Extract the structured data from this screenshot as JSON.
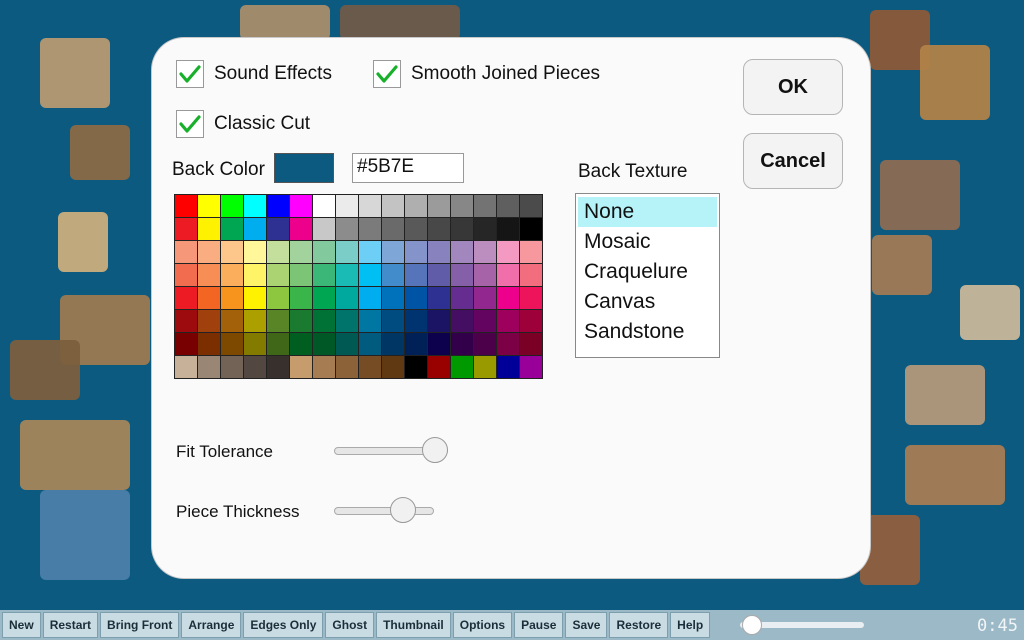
{
  "dialog": {
    "sound_effects": {
      "label": "Sound Effects",
      "checked": true
    },
    "smooth_joined": {
      "label": "Smooth Joined Pieces",
      "checked": true
    },
    "classic_cut": {
      "label": "Classic Cut",
      "checked": true
    },
    "back_color_label": "Back Color",
    "back_color_value": "#5B7E",
    "back_color_swatch": "#0d5a80",
    "back_texture_label": "Back Texture",
    "textures": [
      "None",
      "Mosaic",
      "Craquelure",
      "Canvas",
      "Sandstone"
    ],
    "selected_texture": "None",
    "ok_label": "OK",
    "cancel_label": "Cancel",
    "fit_tolerance_label": "Fit Tolerance",
    "fit_tolerance_value": 1.0,
    "piece_thickness_label": "Piece Thickness",
    "piece_thickness_value": 0.75,
    "palette": [
      [
        "#ff0000",
        "#ffff00",
        "#00ff00",
        "#00ffff",
        "#0000ff",
        "#ff00ff",
        "#ffffff",
        "#ebebeb",
        "#d7d7d7",
        "#c3c3c3",
        "#afafaf",
        "#9b9b9b",
        "#878787",
        "#737373",
        "#5f5f5f",
        "#4b4b4b"
      ],
      [
        "#ed1c24",
        "#fff200",
        "#00a651",
        "#00aeef",
        "#2e3192",
        "#ec008c",
        "#c8c8c8",
        "#8c8c8c",
        "#7b7b7b",
        "#6a6a6a",
        "#595959",
        "#484848",
        "#373737",
        "#262626",
        "#151515",
        "#000000"
      ],
      [
        "#f7977a",
        "#f9ad81",
        "#fdc68a",
        "#fff79a",
        "#c4df9b",
        "#a3d39c",
        "#82ca9d",
        "#7bcdc8",
        "#6ecff6",
        "#7ea7d8",
        "#8493ca",
        "#8882be",
        "#a187be",
        "#bc8dbf",
        "#f49ac2",
        "#f6989d"
      ],
      [
        "#f26c4f",
        "#f68e55",
        "#fbaf5c",
        "#fff467",
        "#acd372",
        "#7cc576",
        "#3bb878",
        "#1abbb4",
        "#00bff3",
        "#438ccb",
        "#5574b9",
        "#605ca8",
        "#855fa8",
        "#a763a8",
        "#f06ea9",
        "#f26d7d"
      ],
      [
        "#ed1c24",
        "#f26522",
        "#f7941d",
        "#fff200",
        "#8dc63f",
        "#39b54a",
        "#00a651",
        "#00a99d",
        "#00aeef",
        "#0072bc",
        "#0054a6",
        "#2e3192",
        "#662d91",
        "#92278f",
        "#ec008c",
        "#ed145b"
      ],
      [
        "#9e0b0f",
        "#a0410d",
        "#a3620a",
        "#aba000",
        "#598527",
        "#1a7b30",
        "#007236",
        "#00746b",
        "#0076a3",
        "#004b80",
        "#003471",
        "#1b1464",
        "#440e62",
        "#630460",
        "#9e005d",
        "#9e0039"
      ],
      [
        "#790000",
        "#7b2e00",
        "#7d4900",
        "#827b00",
        "#406618",
        "#005e20",
        "#005826",
        "#005952",
        "#005b7f",
        "#003663",
        "#002157",
        "#0d004c",
        "#32004b",
        "#4b0049",
        "#7b0046",
        "#7a0026"
      ],
      [
        "#c7b299",
        "#998675",
        "#736357",
        "#534741",
        "#37302d",
        "#c69c6d",
        "#a67c52",
        "#8c6239",
        "#754c24",
        "#603913",
        "#000000",
        "#990000",
        "#009900",
        "#999900",
        "#000099",
        "#990099"
      ]
    ]
  },
  "toolbar": {
    "buttons": [
      "New",
      "Restart",
      "Bring Front",
      "Arrange",
      "Edges Only",
      "Ghost",
      "Thumbnail",
      "Options",
      "Pause",
      "Save",
      "Restore",
      "Help"
    ],
    "zoom_value": 0.0,
    "timer": "0:45"
  }
}
